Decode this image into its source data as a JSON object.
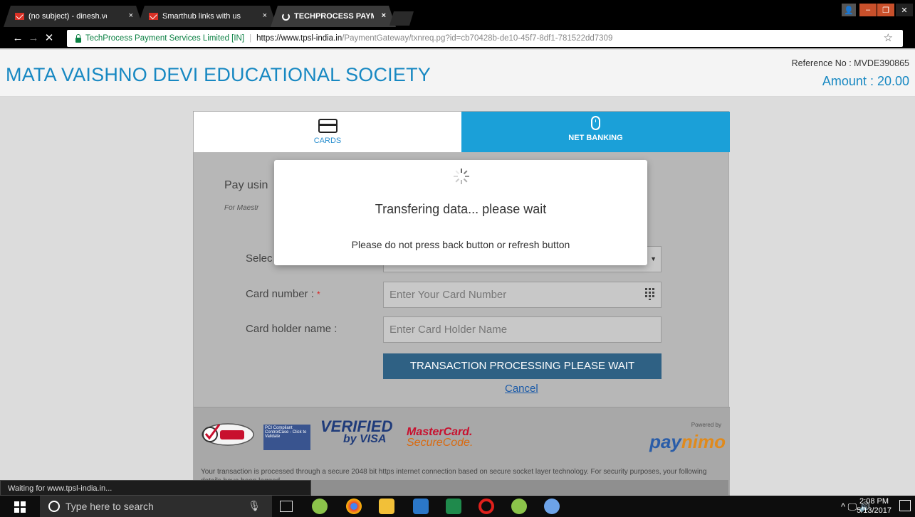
{
  "browser": {
    "tabs": [
      {
        "label": "(no subject) - dinesh.verm",
        "icon": "gmail-icon"
      },
      {
        "label": "Smarthub links with user",
        "icon": "gmail-icon"
      },
      {
        "label": "TECHPROCESS PAYMENT",
        "icon": "loading-icon"
      }
    ],
    "tab_close": "×",
    "url_secure_label": "TechProcess Payment Services Limited [IN]",
    "url_domain": "https://www.tpsl-india.in",
    "url_path": "/PaymentGateway/txnreq.pg?id=cb70428b-de10-45f7-8df1-781522dd7309",
    "back": "←",
    "forward": "→",
    "stop": "✕",
    "bookmark": "☆",
    "status": "Waiting for www.tpsl-india.in..."
  },
  "header": {
    "org_name": "MATA VAISHNO DEVI EDUCATIONAL SOCIETY",
    "reference": "Reference No : MVDE390865",
    "amount": "Amount : 20.00"
  },
  "payment_tabs": {
    "cards": "CARDS",
    "net_banking": "NET BANKING"
  },
  "form": {
    "pay_using": "Pay usin",
    "for_maestro": "For Maestr",
    "select_label": "Selec",
    "card_number_label": "Card number :",
    "required_mark": "*",
    "card_number_placeholder": "Enter Your Card Number",
    "holder_label": "Card holder name :",
    "holder_placeholder": "Enter Card Holder Name",
    "submit": "TRANSACTION PROCESSING PLEASE WAIT",
    "cancel": "Cancel"
  },
  "footer": {
    "verisign": "VeriSign Trusted",
    "pci": "PCI Compliant ControlCase - Click to Validate",
    "verified_top": "VERIFIED",
    "verified_by": "by VISA",
    "mastercard": "MasterCard.",
    "securecode": "SecureCode.",
    "powered_by": "Powered by",
    "paynimo_a": "pay",
    "paynimo_b": "nimo",
    "notice": "Your transaction is processed through a secure 2048 bit https internet connection based on secure socket layer technology. For security purposes, your following details have been logged."
  },
  "modal": {
    "title": "Transfering data... please wait",
    "subtitle": "Please do not press back button or refresh button"
  },
  "taskbar": {
    "search_placeholder": "Type here to search",
    "time": "2:08 PM",
    "date": "5/13/2017",
    "tray": "^ 🖵 🔊"
  }
}
